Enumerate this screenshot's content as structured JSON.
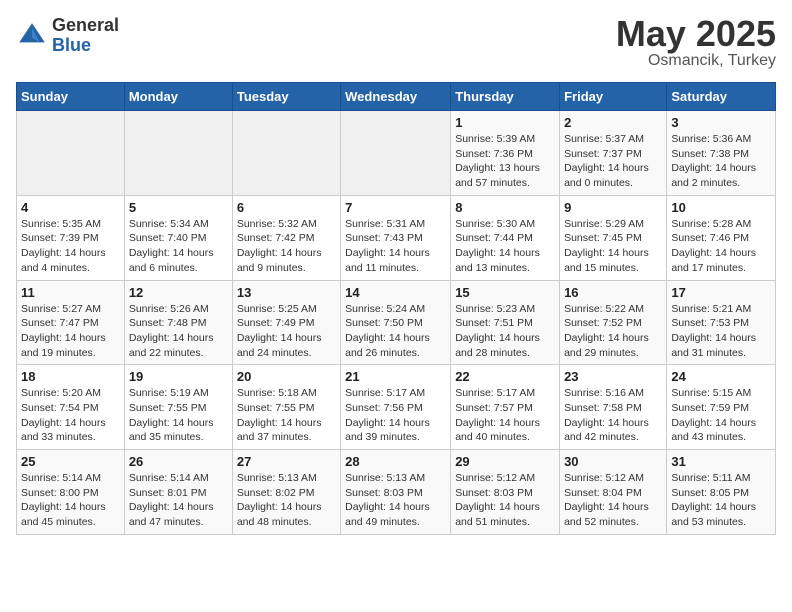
{
  "header": {
    "logo_general": "General",
    "logo_blue": "Blue",
    "month_year": "May 2025",
    "subtitle": "Osmancik, Turkey"
  },
  "weekdays": [
    "Sunday",
    "Monday",
    "Tuesday",
    "Wednesday",
    "Thursday",
    "Friday",
    "Saturday"
  ],
  "weeks": [
    [
      {
        "day": "",
        "info": ""
      },
      {
        "day": "",
        "info": ""
      },
      {
        "day": "",
        "info": ""
      },
      {
        "day": "",
        "info": ""
      },
      {
        "day": "1",
        "info": "Sunrise: 5:39 AM\nSunset: 7:36 PM\nDaylight: 13 hours\nand 57 minutes."
      },
      {
        "day": "2",
        "info": "Sunrise: 5:37 AM\nSunset: 7:37 PM\nDaylight: 14 hours\nand 0 minutes."
      },
      {
        "day": "3",
        "info": "Sunrise: 5:36 AM\nSunset: 7:38 PM\nDaylight: 14 hours\nand 2 minutes."
      }
    ],
    [
      {
        "day": "4",
        "info": "Sunrise: 5:35 AM\nSunset: 7:39 PM\nDaylight: 14 hours\nand 4 minutes."
      },
      {
        "day": "5",
        "info": "Sunrise: 5:34 AM\nSunset: 7:40 PM\nDaylight: 14 hours\nand 6 minutes."
      },
      {
        "day": "6",
        "info": "Sunrise: 5:32 AM\nSunset: 7:42 PM\nDaylight: 14 hours\nand 9 minutes."
      },
      {
        "day": "7",
        "info": "Sunrise: 5:31 AM\nSunset: 7:43 PM\nDaylight: 14 hours\nand 11 minutes."
      },
      {
        "day": "8",
        "info": "Sunrise: 5:30 AM\nSunset: 7:44 PM\nDaylight: 14 hours\nand 13 minutes."
      },
      {
        "day": "9",
        "info": "Sunrise: 5:29 AM\nSunset: 7:45 PM\nDaylight: 14 hours\nand 15 minutes."
      },
      {
        "day": "10",
        "info": "Sunrise: 5:28 AM\nSunset: 7:46 PM\nDaylight: 14 hours\nand 17 minutes."
      }
    ],
    [
      {
        "day": "11",
        "info": "Sunrise: 5:27 AM\nSunset: 7:47 PM\nDaylight: 14 hours\nand 19 minutes."
      },
      {
        "day": "12",
        "info": "Sunrise: 5:26 AM\nSunset: 7:48 PM\nDaylight: 14 hours\nand 22 minutes."
      },
      {
        "day": "13",
        "info": "Sunrise: 5:25 AM\nSunset: 7:49 PM\nDaylight: 14 hours\nand 24 minutes."
      },
      {
        "day": "14",
        "info": "Sunrise: 5:24 AM\nSunset: 7:50 PM\nDaylight: 14 hours\nand 26 minutes."
      },
      {
        "day": "15",
        "info": "Sunrise: 5:23 AM\nSunset: 7:51 PM\nDaylight: 14 hours\nand 28 minutes."
      },
      {
        "day": "16",
        "info": "Sunrise: 5:22 AM\nSunset: 7:52 PM\nDaylight: 14 hours\nand 29 minutes."
      },
      {
        "day": "17",
        "info": "Sunrise: 5:21 AM\nSunset: 7:53 PM\nDaylight: 14 hours\nand 31 minutes."
      }
    ],
    [
      {
        "day": "18",
        "info": "Sunrise: 5:20 AM\nSunset: 7:54 PM\nDaylight: 14 hours\nand 33 minutes."
      },
      {
        "day": "19",
        "info": "Sunrise: 5:19 AM\nSunset: 7:55 PM\nDaylight: 14 hours\nand 35 minutes."
      },
      {
        "day": "20",
        "info": "Sunrise: 5:18 AM\nSunset: 7:55 PM\nDaylight: 14 hours\nand 37 minutes."
      },
      {
        "day": "21",
        "info": "Sunrise: 5:17 AM\nSunset: 7:56 PM\nDaylight: 14 hours\nand 39 minutes."
      },
      {
        "day": "22",
        "info": "Sunrise: 5:17 AM\nSunset: 7:57 PM\nDaylight: 14 hours\nand 40 minutes."
      },
      {
        "day": "23",
        "info": "Sunrise: 5:16 AM\nSunset: 7:58 PM\nDaylight: 14 hours\nand 42 minutes."
      },
      {
        "day": "24",
        "info": "Sunrise: 5:15 AM\nSunset: 7:59 PM\nDaylight: 14 hours\nand 43 minutes."
      }
    ],
    [
      {
        "day": "25",
        "info": "Sunrise: 5:14 AM\nSunset: 8:00 PM\nDaylight: 14 hours\nand 45 minutes."
      },
      {
        "day": "26",
        "info": "Sunrise: 5:14 AM\nSunset: 8:01 PM\nDaylight: 14 hours\nand 47 minutes."
      },
      {
        "day": "27",
        "info": "Sunrise: 5:13 AM\nSunset: 8:02 PM\nDaylight: 14 hours\nand 48 minutes."
      },
      {
        "day": "28",
        "info": "Sunrise: 5:13 AM\nSunset: 8:03 PM\nDaylight: 14 hours\nand 49 minutes."
      },
      {
        "day": "29",
        "info": "Sunrise: 5:12 AM\nSunset: 8:03 PM\nDaylight: 14 hours\nand 51 minutes."
      },
      {
        "day": "30",
        "info": "Sunrise: 5:12 AM\nSunset: 8:04 PM\nDaylight: 14 hours\nand 52 minutes."
      },
      {
        "day": "31",
        "info": "Sunrise: 5:11 AM\nSunset: 8:05 PM\nDaylight: 14 hours\nand 53 minutes."
      }
    ]
  ]
}
